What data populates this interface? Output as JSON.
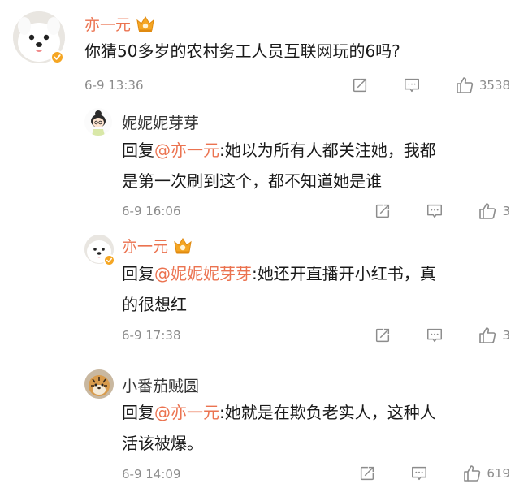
{
  "comments": [
    {
      "username": "亦一元",
      "text": "你猜50多岁的农村务工人员互联网玩的6吗?",
      "time": "6-9 13:36",
      "likes": "3538"
    },
    {
      "username": "妮妮妮芽芽",
      "reply_prefix": "回复",
      "mention": "@亦一元",
      "text_line1": ":她以为所有人都关注她，我都",
      "text_line2": "是第一次刷到这个，都不知道她是谁",
      "time": "6-9 16:06",
      "likes": "3"
    },
    {
      "username": "亦一元",
      "reply_prefix": "回复",
      "mention": "@妮妮妮芽芽",
      "text_line1": ":她还开直播开小红书，真",
      "text_line2": "的很想红",
      "time": "6-9 17:38",
      "likes": "3"
    },
    {
      "username": "小番茄贼圆",
      "reply_prefix": "回复",
      "mention": "@亦一元",
      "text_line1": ":她就是在欺负老实人，这种人",
      "text_line2": "活该被爆。",
      "time": "6-9 14:09",
      "likes": "619"
    }
  ],
  "icons": {
    "share": "share-icon",
    "reply": "comment-icon",
    "like": "thumbs-up-icon",
    "verified": "verified-badge-icon",
    "vip": "vip-crown-icon"
  },
  "colors": {
    "username": "#eb7350",
    "mention": "#eb7350",
    "meta": "#8c8c8c",
    "text": "#1a1a1a"
  }
}
